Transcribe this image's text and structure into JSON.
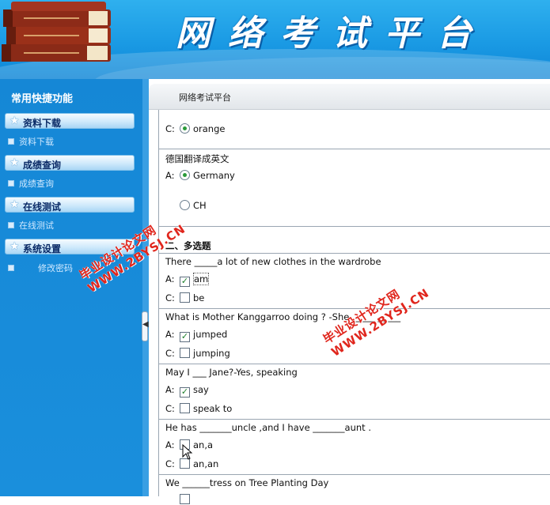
{
  "header": {
    "title": "网络考试平台"
  },
  "sidebar": {
    "title": "常用快捷功能",
    "sections": [
      {
        "label": "资料下载",
        "items": [
          "资料下载"
        ]
      },
      {
        "label": "成绩查询",
        "items": [
          "成绩查询"
        ]
      },
      {
        "label": "在线测试",
        "items": [
          "在线测试"
        ]
      },
      {
        "label": "系统设置",
        "items": [
          "修改密码"
        ]
      }
    ]
  },
  "main": {
    "tab_title": "网络考试平台",
    "q_prev": {
      "option_c": {
        "letter": "C:",
        "text": "orange",
        "checked": true
      }
    },
    "q_translate": {
      "prompt": "德国翻译成英文",
      "option_a": {
        "letter": "A:",
        "text": "Germany",
        "checked": true
      },
      "option_b": {
        "text": "CH",
        "checked": false
      }
    },
    "section2_title": "二、多选题",
    "multi": [
      {
        "prompt": "There _____a lot of new clothes in the wardrobe",
        "options": [
          {
            "letter": "A:",
            "text": "am",
            "checked": true
          },
          {
            "letter": "C:",
            "text": "be",
            "checked": false
          }
        ]
      },
      {
        "prompt": "What is Mother Kanggarroo doing ? -She _____ _____",
        "options": [
          {
            "letter": "A:",
            "text": "jumped",
            "checked": true
          },
          {
            "letter": "C:",
            "text": "jumping",
            "checked": false
          }
        ]
      },
      {
        "prompt": "May I ___ Jane?-Yes, speaking",
        "options": [
          {
            "letter": "A:",
            "text": "say",
            "checked": true
          },
          {
            "letter": "C:",
            "text": "speak to",
            "checked": false
          }
        ]
      },
      {
        "prompt": "He has _______uncle ,and I have _______aunt .",
        "options": [
          {
            "letter": "A:",
            "text": "an,a",
            "checked": false
          },
          {
            "letter": "C:",
            "text": "an,an",
            "checked": false
          }
        ]
      },
      {
        "prompt": "We ______tress on Tree Planting Day",
        "options": []
      }
    ]
  },
  "watermark": {
    "line1": "毕业设计论文网",
    "line2": "WWW.2BYSJ.CN"
  },
  "colors": {
    "header_blue": "#1a9ae4",
    "sidebar_blue": "#1587d6",
    "check_green": "#1a7f2a",
    "watermark_red": "#e0261d"
  }
}
